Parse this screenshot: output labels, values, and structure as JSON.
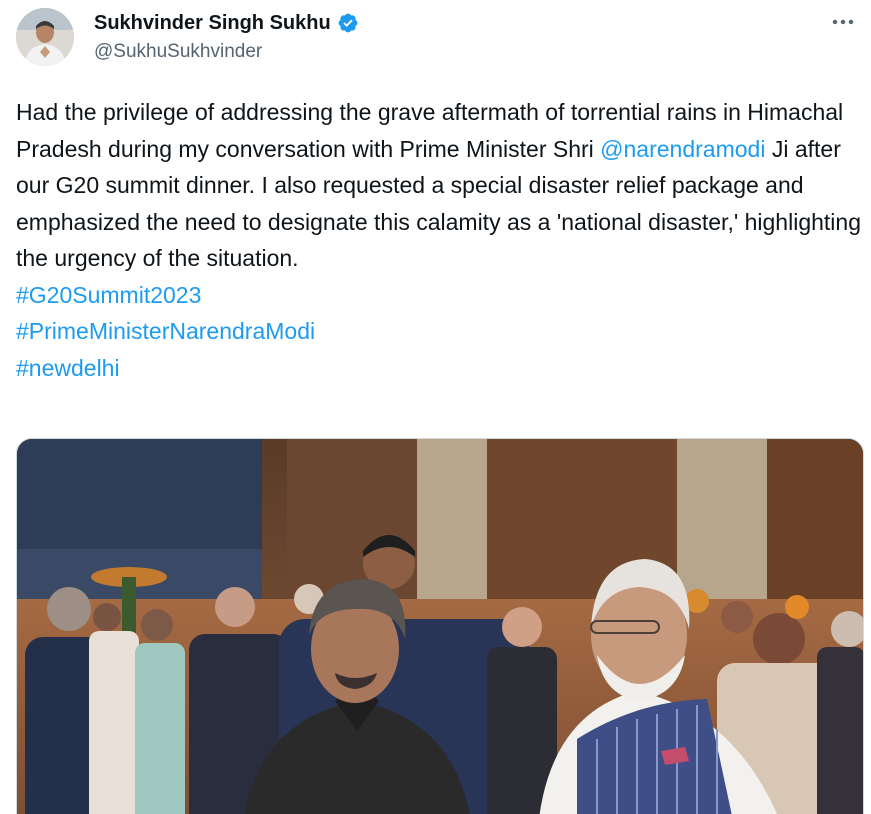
{
  "author": {
    "display_name": "Sukhvinder Singh Sukhu",
    "handle": "@SukhuSukhvinder",
    "verified": true
  },
  "tweet": {
    "text_before_mention": "Had the privilege of addressing the grave aftermath of torrential rains in Himachal Pradesh during my conversation with Prime Minister Shri ",
    "mention": "@narendramodi",
    "text_after_mention": " Ji after our G20 summit dinner. I also requested a special disaster relief package and emphasized the need to designate this calamity as a 'national disaster,' highlighting the urgency of the situation.",
    "hashtags": [
      "#G20Summit2023",
      "#PrimeMinisterNarendraModi",
      "#newdelhi"
    ]
  },
  "icons": {
    "more": "more-options-icon",
    "verified": "verified-badge-icon"
  },
  "colors": {
    "link": "#1d9bf0",
    "text": "#0f1419",
    "secondary": "#536471",
    "verified": "#1d9bf0"
  }
}
